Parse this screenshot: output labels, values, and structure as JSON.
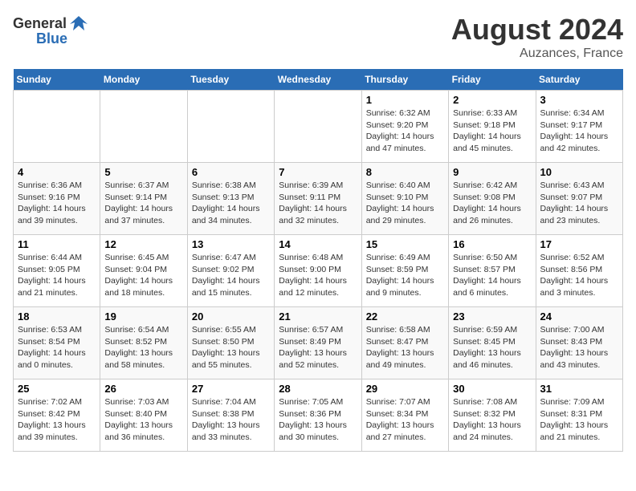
{
  "header": {
    "logo_general": "General",
    "logo_blue": "Blue",
    "title": "August 2024",
    "subtitle": "Auzances, France"
  },
  "calendar": {
    "days_of_week": [
      "Sunday",
      "Monday",
      "Tuesday",
      "Wednesday",
      "Thursday",
      "Friday",
      "Saturday"
    ],
    "weeks": [
      [
        {
          "day": "",
          "info": ""
        },
        {
          "day": "",
          "info": ""
        },
        {
          "day": "",
          "info": ""
        },
        {
          "day": "",
          "info": ""
        },
        {
          "day": "1",
          "info": "Sunrise: 6:32 AM\nSunset: 9:20 PM\nDaylight: 14 hours and 47 minutes."
        },
        {
          "day": "2",
          "info": "Sunrise: 6:33 AM\nSunset: 9:18 PM\nDaylight: 14 hours and 45 minutes."
        },
        {
          "day": "3",
          "info": "Sunrise: 6:34 AM\nSunset: 9:17 PM\nDaylight: 14 hours and 42 minutes."
        }
      ],
      [
        {
          "day": "4",
          "info": "Sunrise: 6:36 AM\nSunset: 9:16 PM\nDaylight: 14 hours and 39 minutes."
        },
        {
          "day": "5",
          "info": "Sunrise: 6:37 AM\nSunset: 9:14 PM\nDaylight: 14 hours and 37 minutes."
        },
        {
          "day": "6",
          "info": "Sunrise: 6:38 AM\nSunset: 9:13 PM\nDaylight: 14 hours and 34 minutes."
        },
        {
          "day": "7",
          "info": "Sunrise: 6:39 AM\nSunset: 9:11 PM\nDaylight: 14 hours and 32 minutes."
        },
        {
          "day": "8",
          "info": "Sunrise: 6:40 AM\nSunset: 9:10 PM\nDaylight: 14 hours and 29 minutes."
        },
        {
          "day": "9",
          "info": "Sunrise: 6:42 AM\nSunset: 9:08 PM\nDaylight: 14 hours and 26 minutes."
        },
        {
          "day": "10",
          "info": "Sunrise: 6:43 AM\nSunset: 9:07 PM\nDaylight: 14 hours and 23 minutes."
        }
      ],
      [
        {
          "day": "11",
          "info": "Sunrise: 6:44 AM\nSunset: 9:05 PM\nDaylight: 14 hours and 21 minutes."
        },
        {
          "day": "12",
          "info": "Sunrise: 6:45 AM\nSunset: 9:04 PM\nDaylight: 14 hours and 18 minutes."
        },
        {
          "day": "13",
          "info": "Sunrise: 6:47 AM\nSunset: 9:02 PM\nDaylight: 14 hours and 15 minutes."
        },
        {
          "day": "14",
          "info": "Sunrise: 6:48 AM\nSunset: 9:00 PM\nDaylight: 14 hours and 12 minutes."
        },
        {
          "day": "15",
          "info": "Sunrise: 6:49 AM\nSunset: 8:59 PM\nDaylight: 14 hours and 9 minutes."
        },
        {
          "day": "16",
          "info": "Sunrise: 6:50 AM\nSunset: 8:57 PM\nDaylight: 14 hours and 6 minutes."
        },
        {
          "day": "17",
          "info": "Sunrise: 6:52 AM\nSunset: 8:56 PM\nDaylight: 14 hours and 3 minutes."
        }
      ],
      [
        {
          "day": "18",
          "info": "Sunrise: 6:53 AM\nSunset: 8:54 PM\nDaylight: 14 hours and 0 minutes."
        },
        {
          "day": "19",
          "info": "Sunrise: 6:54 AM\nSunset: 8:52 PM\nDaylight: 13 hours and 58 minutes."
        },
        {
          "day": "20",
          "info": "Sunrise: 6:55 AM\nSunset: 8:50 PM\nDaylight: 13 hours and 55 minutes."
        },
        {
          "day": "21",
          "info": "Sunrise: 6:57 AM\nSunset: 8:49 PM\nDaylight: 13 hours and 52 minutes."
        },
        {
          "day": "22",
          "info": "Sunrise: 6:58 AM\nSunset: 8:47 PM\nDaylight: 13 hours and 49 minutes."
        },
        {
          "day": "23",
          "info": "Sunrise: 6:59 AM\nSunset: 8:45 PM\nDaylight: 13 hours and 46 minutes."
        },
        {
          "day": "24",
          "info": "Sunrise: 7:00 AM\nSunset: 8:43 PM\nDaylight: 13 hours and 43 minutes."
        }
      ],
      [
        {
          "day": "25",
          "info": "Sunrise: 7:02 AM\nSunset: 8:42 PM\nDaylight: 13 hours and 39 minutes."
        },
        {
          "day": "26",
          "info": "Sunrise: 7:03 AM\nSunset: 8:40 PM\nDaylight: 13 hours and 36 minutes."
        },
        {
          "day": "27",
          "info": "Sunrise: 7:04 AM\nSunset: 8:38 PM\nDaylight: 13 hours and 33 minutes."
        },
        {
          "day": "28",
          "info": "Sunrise: 7:05 AM\nSunset: 8:36 PM\nDaylight: 13 hours and 30 minutes."
        },
        {
          "day": "29",
          "info": "Sunrise: 7:07 AM\nSunset: 8:34 PM\nDaylight: 13 hours and 27 minutes."
        },
        {
          "day": "30",
          "info": "Sunrise: 7:08 AM\nSunset: 8:32 PM\nDaylight: 13 hours and 24 minutes."
        },
        {
          "day": "31",
          "info": "Sunrise: 7:09 AM\nSunset: 8:31 PM\nDaylight: 13 hours and 21 minutes."
        }
      ]
    ]
  }
}
